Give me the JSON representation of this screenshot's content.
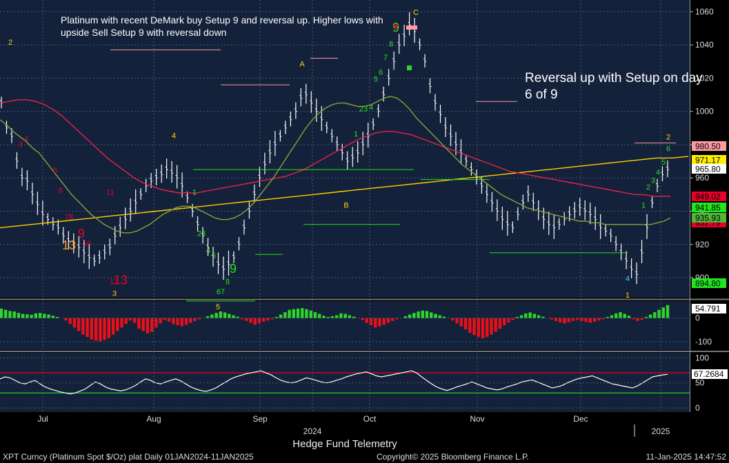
{
  "chart_data": {
    "type": "line",
    "annotations": [
      "Platinum with recent DeMark buy Setup 9 and reversal up.  Higher lows with upside Sell Setup 9 with reversal down",
      "Reversal up with Setup on day 6 of 9"
    ],
    "x_ticks": [
      "Jul",
      "Aug",
      "Sep",
      "2024",
      "Oct",
      "Nov",
      "Dec",
      "2025"
    ],
    "price_panel": {
      "type": "bar",
      "y_ticks": [
        900,
        920,
        940,
        960,
        980,
        1000,
        1020,
        1040,
        1060
      ],
      "ylim": [
        888,
        1067
      ],
      "price": [
        1005,
        990,
        985,
        970,
        960,
        958,
        950,
        944,
        938,
        935,
        932,
        930,
        925,
        922,
        920,
        918,
        915,
        912,
        910,
        912,
        915,
        918,
        925,
        930,
        935,
        940,
        945,
        950,
        955,
        958,
        960,
        962,
        965,
        963,
        960,
        955,
        948,
        940,
        932,
        925,
        918,
        912,
        908,
        905,
        908,
        912,
        920,
        930,
        940,
        950,
        960,
        968,
        975,
        980,
        985,
        990,
        995,
        1000,
        1008,
        1010,
        1005,
        1000,
        995,
        990,
        985,
        980,
        975,
        970,
        972,
        975,
        980,
        985,
        992,
        1000,
        1010,
        1020,
        1030,
        1040,
        1045,
        1052,
        1048,
        1040,
        1030,
        1015,
        1005,
        998,
        990,
        985,
        980,
        975,
        970,
        965,
        960,
        955,
        950,
        945,
        940,
        935,
        932,
        930,
        938,
        945,
        950,
        945,
        940,
        935,
        932,
        930,
        932,
        935,
        938,
        940,
        942,
        940,
        938,
        935,
        930,
        928,
        925,
        920,
        915,
        910,
        905,
        902,
        915,
        930,
        945,
        955,
        962,
        965
      ],
      "sma_20": [
        995,
        992,
        988,
        985,
        982,
        978,
        975,
        970,
        965,
        960,
        955,
        950,
        946,
        942,
        938,
        935,
        932,
        930,
        928,
        927,
        927,
        928,
        930,
        932,
        935,
        938,
        940,
        942,
        943,
        943,
        942,
        940,
        938,
        936,
        935,
        935,
        936,
        938,
        941,
        945,
        950,
        955,
        960,
        966,
        972,
        978,
        984,
        990,
        995,
        999,
        1002,
        1004,
        1005,
        1005,
        1004,
        1003,
        1003,
        1004,
        1006,
        1008,
        1009,
        1008,
        1005,
        1001,
        996,
        992,
        988,
        984,
        980,
        976,
        972,
        968,
        965,
        962,
        959,
        956,
        953,
        950,
        948,
        946,
        944,
        942,
        941,
        940,
        939,
        938,
        937,
        936,
        935,
        934,
        934,
        933,
        933,
        932,
        932,
        932,
        932,
        932,
        932,
        932,
        932,
        933,
        934,
        936
      ],
      "sma_50": [
        1005,
        1006,
        1007,
        1007,
        1006,
        1004,
        1001,
        997,
        992,
        987,
        982,
        977,
        972,
        968,
        964,
        960,
        957,
        955,
        953,
        952,
        951,
        951,
        951,
        952,
        953,
        954,
        955,
        956,
        957,
        958,
        959,
        960,
        961,
        963,
        965,
        968,
        971,
        974,
        977,
        980,
        983,
        985,
        987,
        988,
        988,
        987,
        986,
        984,
        982,
        980,
        978,
        976,
        974,
        972,
        970,
        968,
        966,
        964,
        963,
        962,
        961,
        960,
        959,
        958,
        957,
        956,
        955,
        954,
        953,
        952,
        951,
        950,
        950,
        949,
        949,
        949
      ],
      "sma_200": [
        930,
        931,
        932,
        933,
        934,
        935,
        936,
        937,
        938,
        939,
        940,
        941,
        942,
        943,
        944,
        945,
        946,
        947,
        948,
        949,
        950,
        951,
        952,
        953,
        954,
        955,
        956,
        957,
        958,
        959,
        960,
        961,
        962,
        963,
        964,
        965,
        966,
        967,
        968,
        969,
        970,
        971,
        972,
        972,
        973
      ],
      "levels": [
        {
          "label": "980.50",
          "value": 980.5,
          "color": "#ff9aa2"
        },
        {
          "label": "971.17",
          "value": 971.17,
          "color": "#ffee00"
        },
        {
          "label": "965.80",
          "value": 965.8,
          "color": "#ffffff"
        },
        {
          "label": "949.02",
          "value": 949.02,
          "color": "#e8002a"
        },
        {
          "label": "941.85",
          "value": 941.85,
          "color": "#22e51f"
        },
        {
          "label": "932.79",
          "value": 932.79,
          "color": "#e8002a"
        },
        {
          "label": "935.93",
          "value": 935.93,
          "color": "#4fb73a"
        },
        {
          "label": "894.80",
          "value": 894.8,
          "color": "#22e51f"
        }
      ],
      "demark_labels": [
        {
          "text": "2",
          "color": "#ffd400",
          "x": 0.015,
          "y": 1040
        },
        {
          "text": "3",
          "color": "#e8002a",
          "x": 0.03,
          "y": 979
        },
        {
          "text": "4",
          "color": "#e8002a",
          "x": 0.038,
          "y": 982
        },
        {
          "text": "5",
          "color": "#e8002a",
          "x": 0.08,
          "y": 963
        },
        {
          "text": "6",
          "color": "#e8002a",
          "x": 0.088,
          "y": 951
        },
        {
          "text": "78",
          "color": "#e8002a",
          "x": 0.1,
          "y": 935
        },
        {
          "text": "13",
          "color": "#ff9a1f",
          "x": 0.1,
          "y": 917
        },
        {
          "text": "9",
          "color": "#e8002a",
          "x": 0.118,
          "y": 924
        },
        {
          "text": "10",
          "color": "#e8002a",
          "x": 0.126,
          "y": 919
        },
        {
          "text": "11",
          "color": "#e8002a",
          "x": 0.16,
          "y": 950
        },
        {
          "text": "12",
          "color": "#e8002a",
          "x": 0.165,
          "y": 896
        },
        {
          "text": "13",
          "color": "#e8002a",
          "x": 0.175,
          "y": 896
        },
        {
          "text": "3",
          "color": "#ffd400",
          "x": 0.166,
          "y": 889
        },
        {
          "text": "4",
          "color": "#ffd400",
          "x": 0.252,
          "y": 984
        },
        {
          "text": "1",
          "color": "#22e51f",
          "x": 0.282,
          "y": 950
        },
        {
          "text": "23",
          "color": "#22e51f",
          "x": 0.292,
          "y": 925
        },
        {
          "text": "4",
          "color": "#22e51f",
          "x": 0.302,
          "y": 915
        },
        {
          "text": "5",
          "color": "#22e51f",
          "x": 0.31,
          "y": 912
        },
        {
          "text": "9",
          "color": "#22e51f",
          "x": 0.338,
          "y": 903
        },
        {
          "text": "8",
          "color": "#22e51f",
          "x": 0.33,
          "y": 896
        },
        {
          "text": "67",
          "color": "#22e51f",
          "x": 0.32,
          "y": 890
        },
        {
          "text": "5",
          "color": "#ffd400",
          "x": 0.316,
          "y": 881
        },
        {
          "text": "A",
          "color": "#ffd400",
          "x": 0.438,
          "y": 1027
        },
        {
          "text": "B",
          "color": "#ffd400",
          "x": 0.502,
          "y": 942
        },
        {
          "text": "1",
          "color": "#22e51f",
          "x": 0.516,
          "y": 985
        },
        {
          "text": "23",
          "color": "#22e51f",
          "x": 0.527,
          "y": 1000
        },
        {
          "text": "4",
          "color": "#22e51f",
          "x": 0.538,
          "y": 1001
        },
        {
          "text": "5",
          "color": "#22e51f",
          "x": 0.545,
          "y": 1018
        },
        {
          "text": "6",
          "color": "#22e51f",
          "x": 0.552,
          "y": 1022
        },
        {
          "text": "7",
          "color": "#22e51f",
          "x": 0.559,
          "y": 1031
        },
        {
          "text": "8",
          "color": "#22e51f",
          "x": 0.567,
          "y": 1039
        },
        {
          "text": "9",
          "color": "#22e51f",
          "x": 0.574,
          "y": 1048
        },
        {
          "text": "C",
          "color": "#ffd400",
          "x": 0.603,
          "y": 1058
        },
        {
          "text": "4",
          "color": "#4fc3ff",
          "x": 0.91,
          "y": 898
        },
        {
          "text": "1",
          "color": "#ffd400",
          "x": 0.91,
          "y": 888
        },
        {
          "text": "1",
          "color": "#22e51f",
          "x": 0.933,
          "y": 942
        },
        {
          "text": "2",
          "color": "#22e51f",
          "x": 0.94,
          "y": 953
        },
        {
          "text": "3",
          "color": "#22e51f",
          "x": 0.947,
          "y": 957
        },
        {
          "text": "4",
          "color": "#22e51f",
          "x": 0.954,
          "y": 962
        },
        {
          "text": "5",
          "color": "#22e51f",
          "x": 0.962,
          "y": 968
        },
        {
          "text": "6",
          "color": "#22e51f",
          "x": 0.969,
          "y": 976
        },
        {
          "text": "2",
          "color": "#ffd400",
          "x": 0.969,
          "y": 983
        }
      ]
    },
    "histogram_panel": {
      "type": "bar",
      "y_ticks": [
        -100,
        0
      ],
      "ylim": [
        -135,
        72
      ],
      "current_label": "54.791",
      "values": [
        40,
        35,
        30,
        28,
        22,
        18,
        16,
        14,
        20,
        22,
        18,
        15,
        10,
        5,
        0,
        -10,
        -25,
        -40,
        -55,
        -70,
        -80,
        -90,
        -95,
        -98,
        -92,
        -85,
        -70,
        -55,
        -40,
        -25,
        -10,
        -20,
        -45,
        -55,
        -65,
        -58,
        -40,
        -22,
        -8,
        -15,
        -25,
        -30,
        -35,
        -28,
        -20,
        -12,
        -5,
        0,
        8,
        15,
        22,
        28,
        24,
        18,
        12,
        6,
        -5,
        -12,
        -20,
        -28,
        -22,
        -15,
        -10,
        -5,
        5,
        15,
        25,
        35,
        38,
        40,
        42,
        38,
        32,
        25,
        18,
        10,
        5,
        8,
        12,
        20,
        18,
        12,
        6,
        0,
        -8,
        -20,
        -30,
        -40,
        -35,
        -28,
        -20,
        -12,
        -5,
        0,
        8,
        15,
        22,
        28,
        32,
        30,
        24,
        18,
        12,
        6,
        0,
        -10,
        -22,
        -35,
        -48,
        -62,
        -72,
        -80,
        -85,
        -80,
        -70,
        -58,
        -45,
        -30,
        -18,
        -8,
        5,
        12,
        20,
        24,
        18,
        12,
        6,
        0,
        -6,
        -12,
        -18,
        -22,
        -18,
        -12,
        -8,
        -12,
        -16,
        -20,
        -15,
        -10,
        -5,
        5,
        12,
        20,
        25,
        18,
        10,
        -5,
        -12,
        -8,
        5,
        15,
        25,
        35,
        45,
        55
      ]
    },
    "oscillator_panel": {
      "type": "line",
      "y_ticks": [
        0,
        50,
        100
      ],
      "ylim": [
        -8,
        110
      ],
      "upper_band": 70,
      "lower_band": 30,
      "current_label": "67.2684",
      "values": [
        58,
        62,
        60,
        55,
        50,
        48,
        52,
        55,
        48,
        42,
        38,
        35,
        32,
        30,
        28,
        30,
        34,
        38,
        45,
        52,
        48,
        42,
        38,
        36,
        34,
        36,
        40,
        45,
        52,
        58,
        55,
        50,
        48,
        52,
        55,
        58,
        54,
        48,
        42,
        38,
        35,
        33,
        36,
        40,
        46,
        52,
        58,
        62,
        65,
        68,
        70,
        72,
        74,
        70,
        66,
        60,
        55,
        52,
        50,
        52,
        56,
        60,
        58,
        55,
        52,
        50,
        52,
        55,
        58,
        62,
        65,
        68,
        70,
        72,
        68,
        64,
        62,
        64,
        66,
        68,
        70,
        72,
        74,
        70,
        62,
        55,
        48,
        42,
        38,
        35,
        38,
        42,
        45,
        48,
        52,
        48,
        44,
        40,
        38,
        36,
        38,
        42,
        45,
        48,
        52,
        54,
        56,
        52,
        48,
        44,
        40,
        42,
        45,
        50,
        54,
        58,
        60,
        62,
        64,
        60,
        56,
        52,
        48,
        46,
        44,
        42,
        40,
        44,
        50,
        56,
        62,
        64,
        66,
        67
      ]
    },
    "footer": {
      "title": "Hedge Fund Telemetry",
      "instrument": "XPT Curncy (Platinum Spot  $/Oz) plat  Daily 01JAN2024-11JAN2025",
      "copyright": "Copyright© 2025 Bloomberg Finance L.P.",
      "timestamp": "11-Jan-2025  14:47:52"
    }
  }
}
